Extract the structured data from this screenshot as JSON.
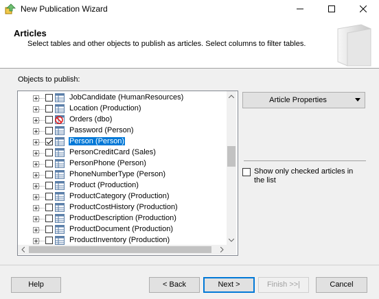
{
  "window": {
    "title": "New Publication Wizard"
  },
  "header": {
    "title": "Articles",
    "description": "Select tables and other objects to publish as articles. Select columns to filter tables."
  },
  "objects_label": "Objects to publish:",
  "tree": {
    "items": [
      {
        "label": "JobCandidate (HumanResources)",
        "checked": false,
        "selected": false,
        "icon": "table-icon"
      },
      {
        "label": "Location (Production)",
        "checked": false,
        "selected": false,
        "icon": "table-icon"
      },
      {
        "label": "Orders (dbo)",
        "checked": false,
        "selected": false,
        "icon": "table-blocked-icon"
      },
      {
        "label": "Password (Person)",
        "checked": false,
        "selected": false,
        "icon": "table-icon"
      },
      {
        "label": "Person (Person)",
        "checked": true,
        "selected": true,
        "icon": "table-icon"
      },
      {
        "label": "PersonCreditCard (Sales)",
        "checked": false,
        "selected": false,
        "icon": "table-icon"
      },
      {
        "label": "PersonPhone (Person)",
        "checked": false,
        "selected": false,
        "icon": "table-icon"
      },
      {
        "label": "PhoneNumberType (Person)",
        "checked": false,
        "selected": false,
        "icon": "table-icon"
      },
      {
        "label": "Product (Production)",
        "checked": false,
        "selected": false,
        "icon": "table-icon"
      },
      {
        "label": "ProductCategory (Production)",
        "checked": false,
        "selected": false,
        "icon": "table-icon"
      },
      {
        "label": "ProductCostHistory (Production)",
        "checked": false,
        "selected": false,
        "icon": "table-icon"
      },
      {
        "label": "ProductDescription (Production)",
        "checked": false,
        "selected": false,
        "icon": "table-icon"
      },
      {
        "label": "ProductDocument (Production)",
        "checked": false,
        "selected": false,
        "icon": "table-icon"
      },
      {
        "label": "ProductInventory (Production)",
        "checked": false,
        "selected": false,
        "icon": "table-icon"
      }
    ]
  },
  "article_properties_label": "Article Properties",
  "show_only_checked_label": "Show only checked articles in the list",
  "buttons": {
    "help": "Help",
    "back": "< Back",
    "next": "Next >",
    "finish": "Finish >>|",
    "cancel": "Cancel"
  },
  "colors": {
    "selection": "#0078d7",
    "focus_border": "#0078d7"
  }
}
